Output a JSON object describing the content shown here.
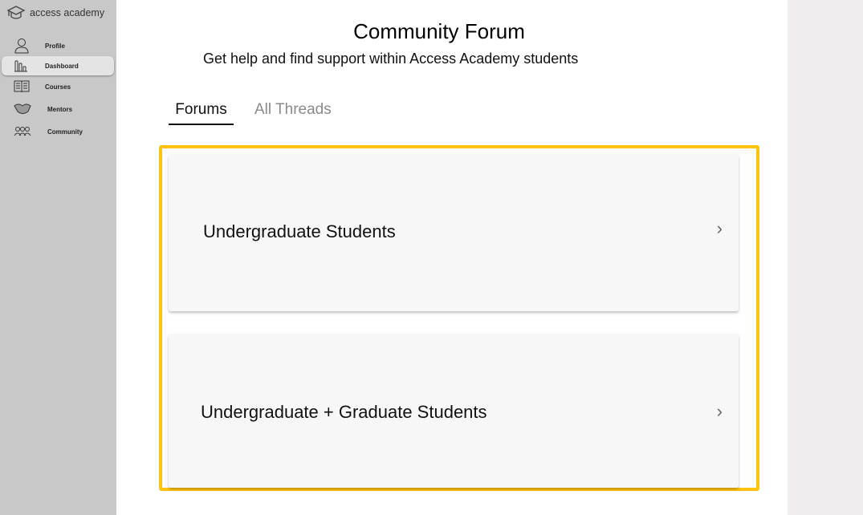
{
  "sidebar": {
    "brand": "access academy",
    "items": [
      {
        "label": "Profile",
        "icon": "user-icon"
      },
      {
        "label": "Dashboard",
        "icon": "bar-chart-icon",
        "active": true
      },
      {
        "label": "Courses",
        "icon": "book-icon"
      },
      {
        "label": "Mentors",
        "icon": "handshake-icon"
      },
      {
        "label": "Community",
        "icon": "group-icon"
      }
    ]
  },
  "header": {
    "title": "Community Forum",
    "subtitle": "Get help and find support within Access Academy students"
  },
  "tabs": [
    {
      "label": "Forums",
      "active": true
    },
    {
      "label": "All Threads",
      "active": false
    }
  ],
  "forums": [
    {
      "label": "Undergraduate Students"
    },
    {
      "label": "Undergraduate + Graduate Students"
    }
  ],
  "colors": {
    "highlight": "#ffc20e",
    "sidebar": "#c8c8c8"
  }
}
